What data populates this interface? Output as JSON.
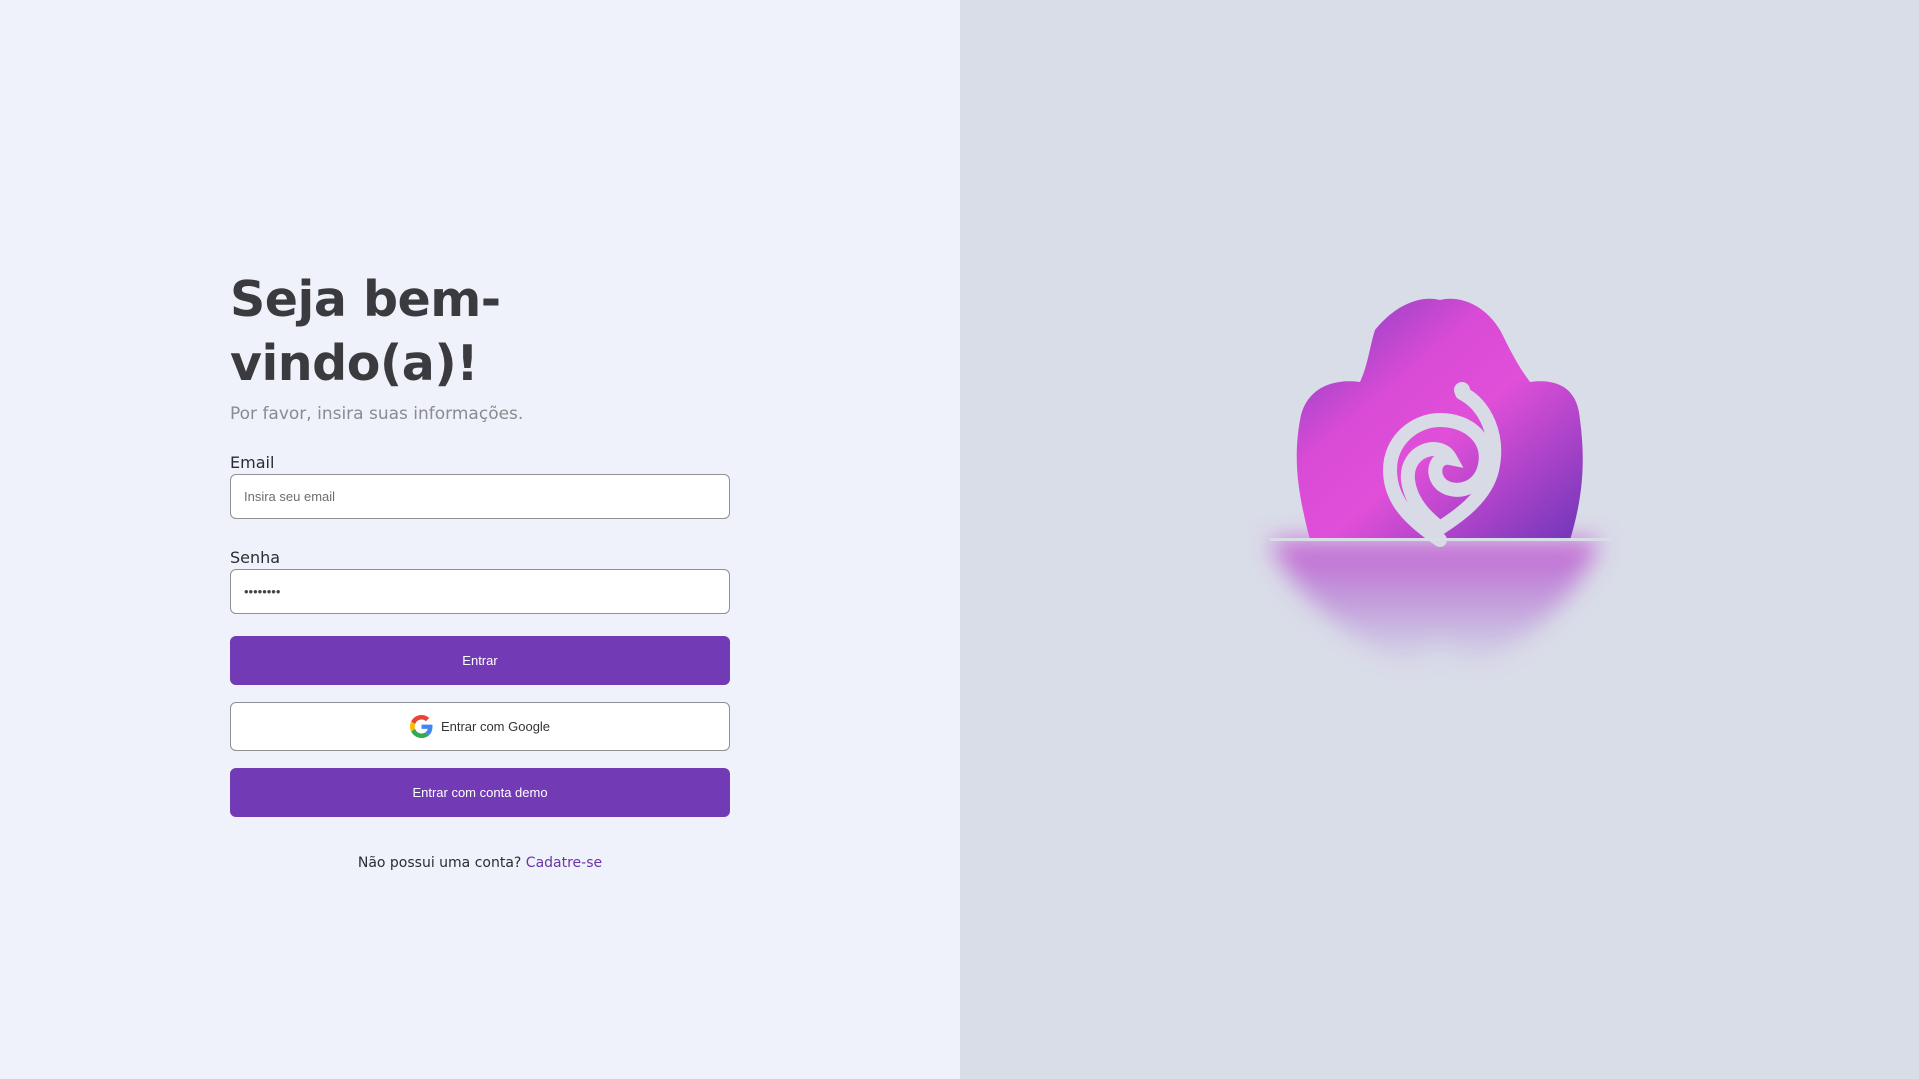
{
  "login": {
    "title": "Seja bem-vindo(a)!",
    "subtitle": "Por favor, insira suas informações.",
    "email": {
      "label": "Email",
      "placeholder": "Insira seu email",
      "value": ""
    },
    "password": {
      "label": "Senha",
      "value": "••••••••"
    },
    "submit_label": "Entrar",
    "google_label": "Entrar com Google",
    "demo_label": "Entrar com conta demo",
    "signup_prompt": "Não possui uma conta?",
    "signup_link": "Cadatre-se"
  },
  "icons": {
    "google": "google-icon",
    "logo": "flower-logo"
  },
  "colors": {
    "primary": "#723ab4",
    "left_bg": "#eff2fa",
    "right_bg": "#d9dde8",
    "logo_pink": "#d94bd6",
    "logo_purple": "#7a3dc0"
  }
}
